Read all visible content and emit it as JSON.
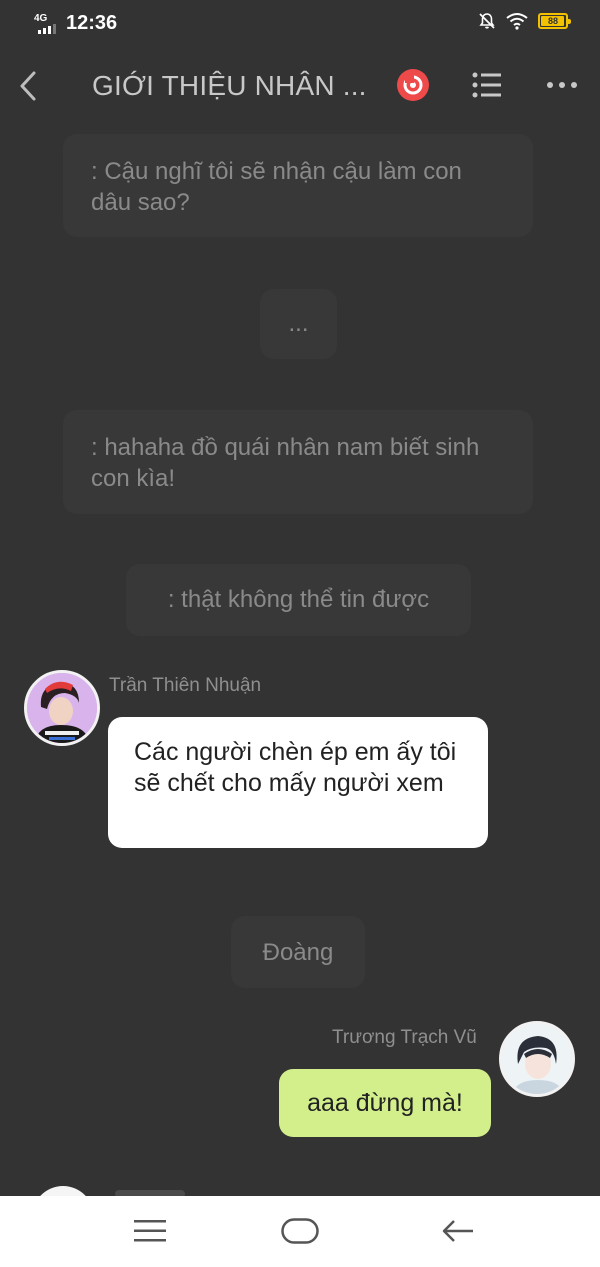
{
  "status_bar": {
    "network": "4G",
    "time": "12:36",
    "battery_level": "88",
    "icons": [
      "signal-icon",
      "mute-icon",
      "wifi-icon",
      "battery-icon"
    ]
  },
  "header": {
    "title": "GIỚI THIỆU NHÂN ...",
    "icons": [
      "back-icon",
      "eye-icon",
      "list-icon",
      "more-icon"
    ],
    "accent_color": "#ef4a4a"
  },
  "messages": [
    {
      "type": "narration",
      "text": ": Cậu nghĩ tôi sẽ nhận cậu làm con dâu sao?"
    },
    {
      "type": "narration",
      "text": "..."
    },
    {
      "type": "narration",
      "text": ": hahaha đồ quái nhân nam biết sinh con kìa!"
    },
    {
      "type": "narration",
      "text": ": thật không thể tin được"
    },
    {
      "type": "character",
      "side": "left",
      "name": "Trần Thiên Nhuận",
      "text": "Các người chèn ép em ấy tôi sẽ chết cho mấy người xem"
    },
    {
      "type": "narration",
      "text": "Đoàng"
    },
    {
      "type": "character",
      "side": "right",
      "name": "Trương Trạch Vũ",
      "text": "aaa đừng mà!"
    }
  ],
  "colors": {
    "background": "#333333",
    "narration_bubble": "#383838",
    "left_bubble": "#ffffff",
    "right_bubble": "#d2ef8c",
    "battery": "#f2c200"
  },
  "nav_bar": {
    "icons": [
      "menu-icon",
      "home-icon",
      "back-arrow-icon"
    ]
  }
}
